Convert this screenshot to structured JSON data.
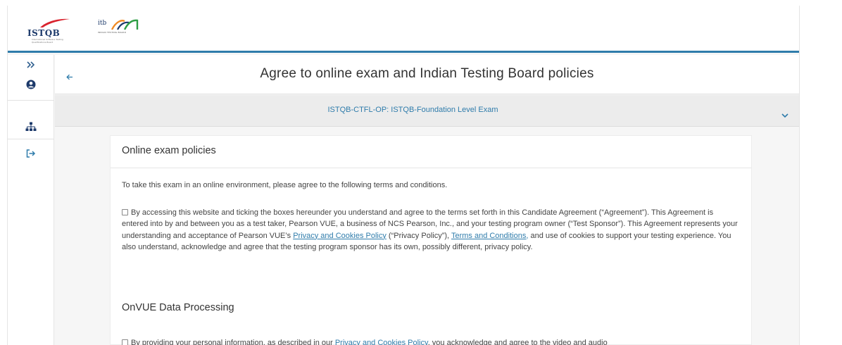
{
  "header": {
    "istqb_logo_text": "ISTQB",
    "istqb_tagline": "International Software Testing Qualifications Board",
    "itb_logo_text": "itb",
    "itb_subtitle": "INDIAN TESTING BOARD",
    "accent_color": "#2f7cab"
  },
  "sidebar": {
    "items": [
      {
        "name": "expand",
        "icon": "double-chevron-right-icon"
      },
      {
        "name": "profile",
        "icon": "user-circle-icon"
      },
      {
        "name": "sitemap",
        "icon": "sitemap-icon"
      },
      {
        "name": "sign-out",
        "icon": "sign-out-icon"
      }
    ]
  },
  "page": {
    "title": "Agree to online exam and Indian Testing Board policies",
    "back_icon": "arrow-left-icon"
  },
  "exam": {
    "name": "ISTQB-CTFL-OP: ISTQB-Foundation Level Exam",
    "chevron_icon": "chevron-down-icon"
  },
  "policies": {
    "heading": "Online exam policies",
    "intro": "To take this exam in an online environment, please agree to the following terms and conditions.",
    "agreement": {
      "text1": "By accessing this website and ticking the boxes hereunder you understand and agree to the terms set forth in this Candidate Agreement (“Agreement”). This Agreement is entered into by and between you as a test taker, Pearson VUE, a business of NCS Pearson, Inc., and your testing program owner (“Test Sponsor”). This Agreement represents your understanding and acceptance of Pearson VUE’s ",
      "link1": "Privacy and Cookies Policy",
      "text2": " (“Privacy Policy”), ",
      "link2": "Terms and Conditions,",
      "text3": " and use of cookies to support your testing experience. You also understand, acknowledge and agree that the testing program sponsor has its own, possibly different, privacy policy."
    },
    "data_processing": {
      "heading": "OnVUE Data Processing",
      "text1": "By providing your personal information, as described in our ",
      "link1": "Privacy and Cookies Policy",
      "text2": ", you acknowledge and agree to the video and audio"
    }
  }
}
